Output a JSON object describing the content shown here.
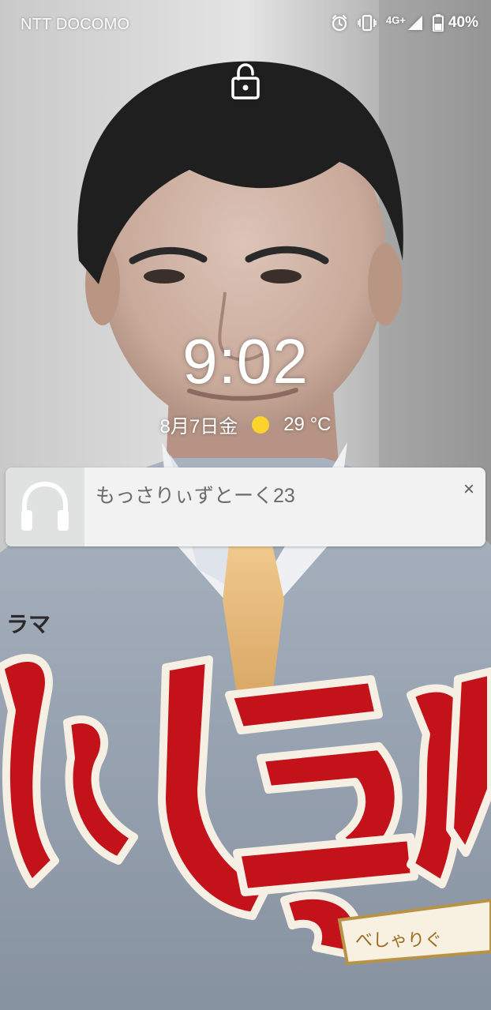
{
  "status_bar": {
    "carrier": "NTT DOCOMO",
    "network": "4G+",
    "battery": "40%",
    "icons": [
      "alarm-icon",
      "vibrate-icon",
      "signal-icon",
      "battery-icon"
    ]
  },
  "lock_screen": {
    "lock_icon": "lock-open-icon",
    "time": "9:02",
    "date": "8月7日金",
    "weather_icon": "sun-icon",
    "temperature": "29 °C"
  },
  "notification": {
    "icon": "headphones-icon",
    "title": "もっさりぃずとーく23",
    "close_label": "×"
  },
  "colors": {
    "text_on_wallpaper": "#ffffff",
    "notification_bg": "#f2f2f2",
    "sun": "#fbd32b",
    "wallpaper_title_red": "#c4121a"
  }
}
